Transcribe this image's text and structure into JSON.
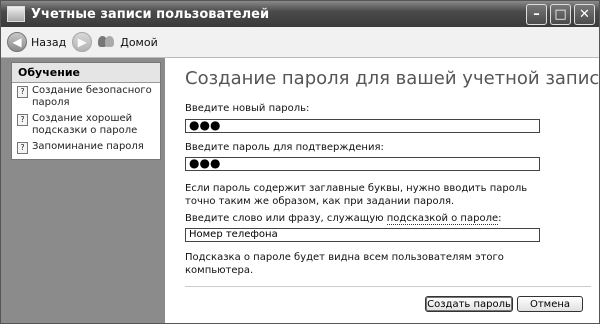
{
  "window": {
    "title": "Учетные записи пользователей"
  },
  "toolbar": {
    "back_label": "Назад",
    "home_label": "Домой"
  },
  "sidebar": {
    "title": "Обучение",
    "items": [
      {
        "label": "Создание безопасного пароля"
      },
      {
        "label": "Создание хорошей подсказки о пароле"
      },
      {
        "label": "Запоминание пароля"
      }
    ]
  },
  "main": {
    "heading": "Создание пароля для вашей учетной записи",
    "new_password_label": "Введите новый пароль:",
    "new_password_value": "●●●",
    "confirm_label": "Введите пароль для подтверждения:",
    "confirm_value": "●●●",
    "case_note": "Если пароль содержит заглавные буквы, нужно вводить пароль точно таким же образом, как при задании пароля.",
    "hint_prompt_prefix": "Введите слово или фразу, служащую ",
    "hint_prompt_link": "подсказкой о пароле",
    "hint_prompt_suffix": ":",
    "hint_value": "Номер телефона",
    "hint_note": "Подсказка о пароле будет видна всем пользователям этого компьютера.",
    "create_button": "Создать пароль",
    "cancel_button": "Отмена"
  }
}
